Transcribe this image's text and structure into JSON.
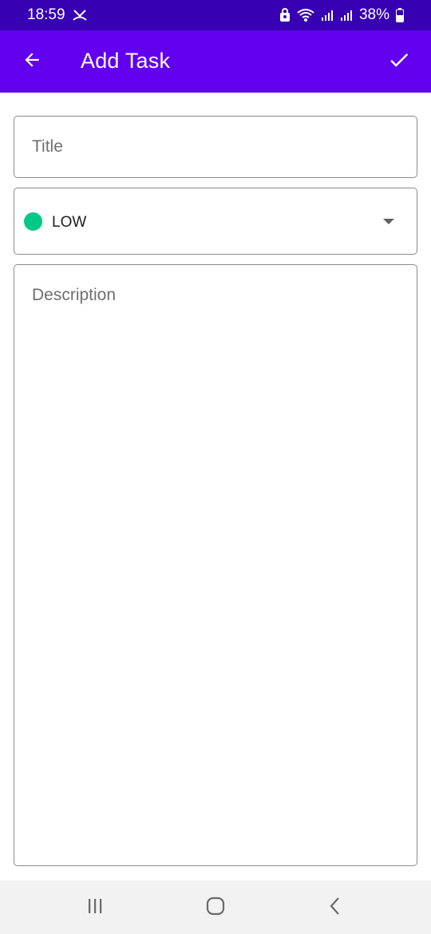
{
  "status_bar": {
    "time": "18:59",
    "battery": "38%",
    "icons": [
      "call-missed-icon",
      "lock-icon",
      "wifi-icon",
      "signal-icon",
      "signal-icon",
      "battery-icon"
    ]
  },
  "app_bar": {
    "title": "Add Task",
    "back_icon": "arrow-back-icon",
    "confirm_icon": "check-icon",
    "color": "#6200ee",
    "status_color": "#3700b3"
  },
  "form": {
    "title_placeholder": "Title",
    "title_value": "",
    "priority": {
      "selected": "LOW",
      "dot_color": "#00c985"
    },
    "description_placeholder": "Description",
    "description_value": ""
  },
  "nav_bar": {
    "icons": [
      "recents-icon",
      "home-icon",
      "back-icon"
    ]
  }
}
